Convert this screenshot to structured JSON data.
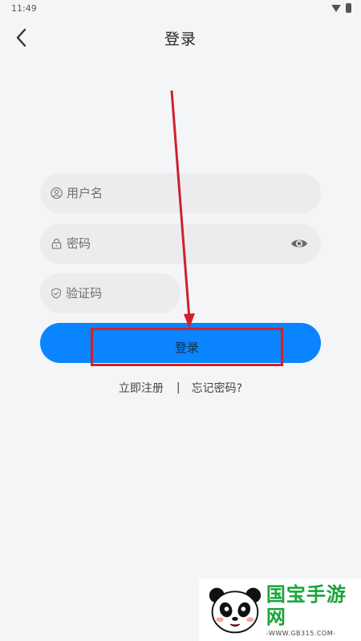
{
  "status_bar": {
    "time": "11:49"
  },
  "header": {
    "title": "登录",
    "back_icon": "chevron-left-icon"
  },
  "form": {
    "username": {
      "placeholder": "用户名",
      "icon": "user-circle-icon"
    },
    "password": {
      "placeholder": "密码",
      "icon": "lock-icon",
      "toggle_icon": "eye-icon"
    },
    "captcha": {
      "placeholder": "验证码",
      "icon": "shield-check-icon"
    },
    "login_button": {
      "label": "登录",
      "color": "#0a84ff"
    }
  },
  "links": {
    "register": "立即注册",
    "separator": "|",
    "forgot": "忘记密码?"
  },
  "annotation": {
    "color": "#d0212b"
  },
  "watermark": {
    "title": "国宝手游网",
    "url": "-WWW.GB315.COM-",
    "color": "#1aa33a"
  }
}
